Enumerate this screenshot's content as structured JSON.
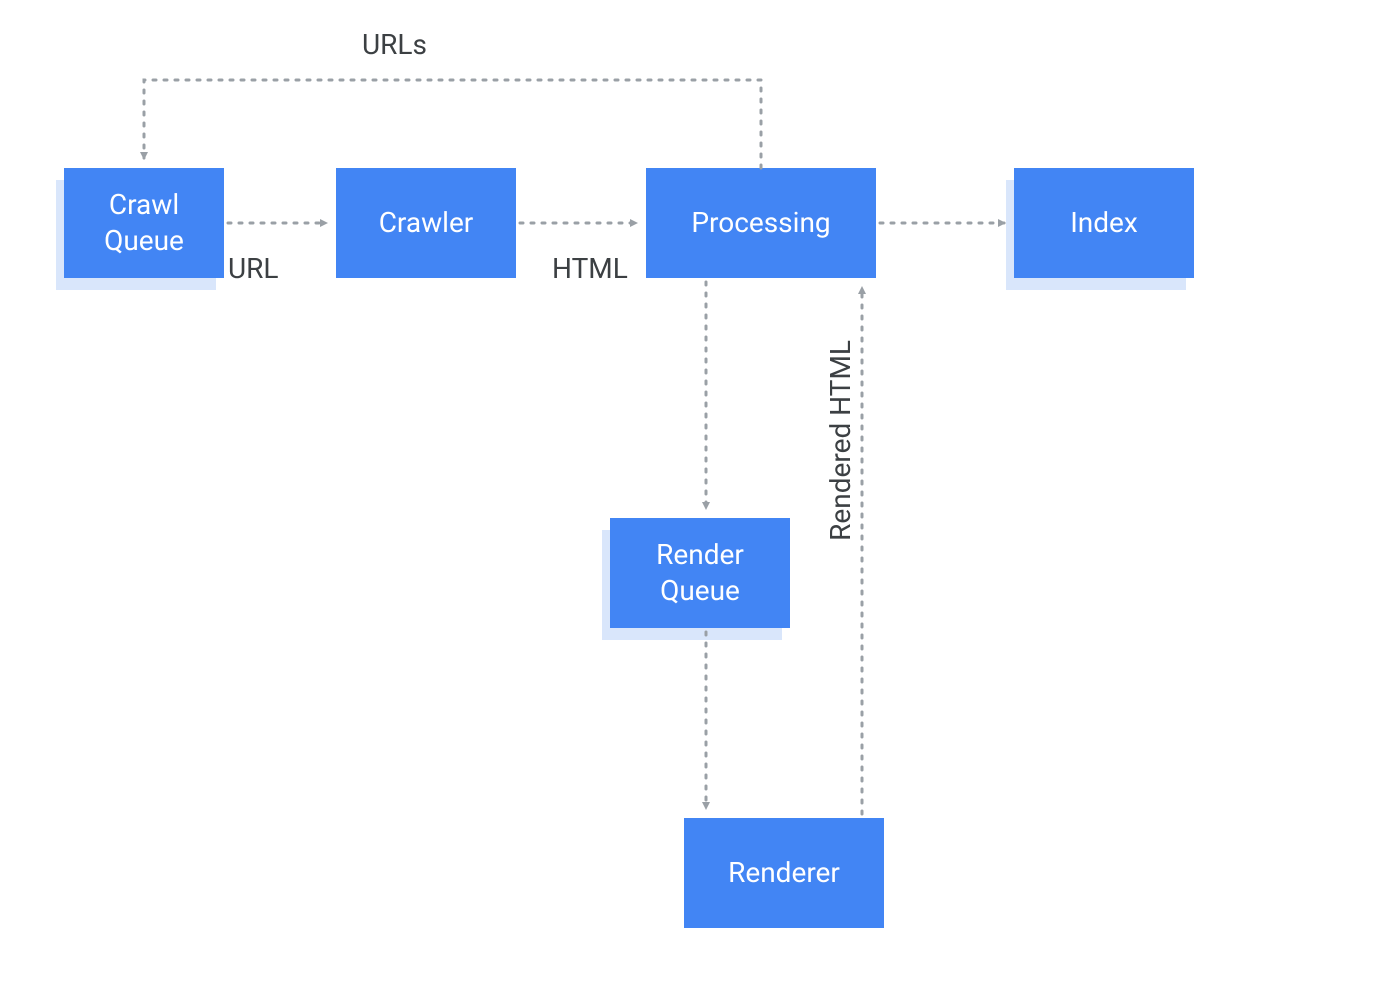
{
  "colors": {
    "nodeFill": "#4285F4",
    "nodeShadow": "#d9e6fb",
    "textLight": "#ffffff",
    "textDark": "#3c4043",
    "connector": "#9aa0a6"
  },
  "nodes": {
    "crawlQueue": "Crawl\nQueue",
    "crawler": "Crawler",
    "processing": "Processing",
    "index": "Index",
    "renderQueue": "Render\nQueue",
    "renderer": "Renderer"
  },
  "edges": {
    "urls": "URLs",
    "url": "URL",
    "html": "HTML",
    "renderedHtml": "Rendered HTML"
  }
}
